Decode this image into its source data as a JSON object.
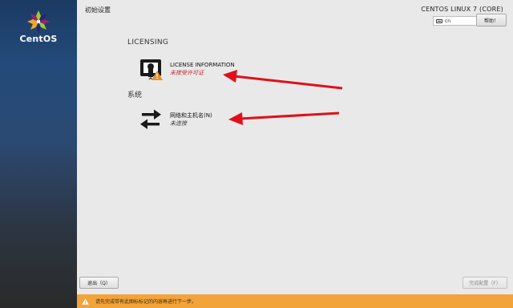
{
  "sidebar": {
    "logo_text": "CentOS"
  },
  "header": {
    "page_title": "初始设置",
    "product_title": "CENTOS LINUX 7 (CORE)",
    "keyboard_layout": "cn",
    "help_label": "帮助！"
  },
  "categories": [
    {
      "title": "LICENSING",
      "spokes": [
        {
          "label": "LICENSE INFORMATION",
          "status": "未接受许可证",
          "icon": "license-warning-icon",
          "status_color": "#c6262e"
        }
      ]
    },
    {
      "title": "系统",
      "spokes": [
        {
          "label": "网络和主机名(N)",
          "status": "未连接",
          "icon": "network-arrows-icon",
          "status_color": "#333333"
        }
      ]
    }
  ],
  "footer": {
    "quit_label": "退出（Q）",
    "finish_label": "完成配置（F）",
    "warning_text": "请先完成带有此图标标记的内容再进行下一步。"
  },
  "colors": {
    "warning_bar": "#f2a33a",
    "annotation_arrow": "#e0101a",
    "sidebar_top": "#1b3a63"
  }
}
